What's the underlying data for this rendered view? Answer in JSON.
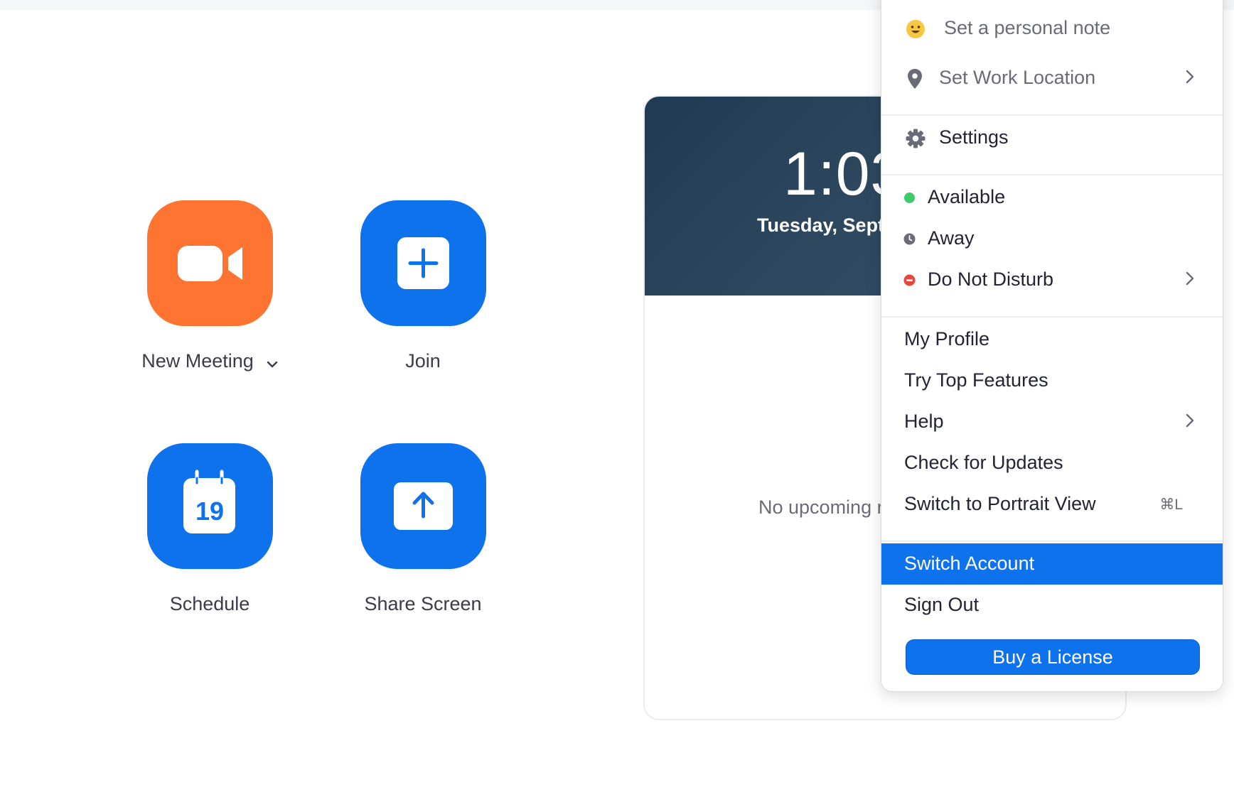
{
  "actions": {
    "new_meeting": "New Meeting",
    "join": "Join",
    "schedule": "Schedule",
    "schedule_day": "19",
    "share_screen": "Share Screen"
  },
  "card": {
    "time": "1:03",
    "date": "Tuesday, Septe",
    "no_upcoming": "No upcoming r"
  },
  "menu": {
    "personal_note": "Set a personal note",
    "work_location": "Set Work Location",
    "settings": "Settings",
    "available": "Available",
    "away": "Away",
    "do_not_disturb": "Do Not Disturb",
    "my_profile": "My Profile",
    "try_top_features": "Try Top Features",
    "help": "Help",
    "check_updates": "Check for Updates",
    "portrait_view": "Switch to Portrait View",
    "portrait_shortcut": "⌘L",
    "switch_account": "Switch Account",
    "sign_out": "Sign Out",
    "buy_license": "Buy a License"
  },
  "icons": {
    "new_meeting": "video-camera-icon",
    "join": "plus-icon",
    "schedule": "calendar-icon",
    "share_screen": "upload-arrow-icon",
    "personal_note": "smiley-emoji-icon",
    "work_location": "location-pin-icon",
    "settings": "gear-icon",
    "away": "clock-icon",
    "do_not_disturb": "minus-circle-icon",
    "submenu": "chevron-right-icon"
  },
  "colors": {
    "brand_blue": "#0e72ed",
    "new_meeting_orange": "#fe7430",
    "available_green": "#3ec96a",
    "dnd_red": "#e8453c",
    "away_gray": "#6b6b78"
  }
}
